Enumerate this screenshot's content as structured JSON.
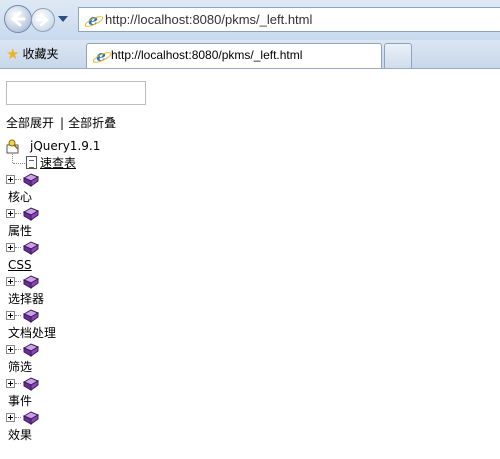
{
  "browser": {
    "address_url": "http://localhost:8080/pkms/_left.html",
    "favorites_label": "收藏夹",
    "tab_title": "http://localhost:8080/pkms/_left.html"
  },
  "page": {
    "search": {
      "value": "",
      "placeholder": ""
    },
    "expand_all": "全部展开",
    "separator": "|",
    "collapse_all": "全部折叠",
    "tree": {
      "root": {
        "label": "jQuery1.9.1",
        "icon": "key-folder-icon"
      },
      "child": {
        "label": "速查表",
        "icon": "document-icon"
      },
      "groups": [
        {
          "label": "核心",
          "underlined": false
        },
        {
          "label": "属性",
          "underlined": false
        },
        {
          "label": "CSS",
          "underlined": true
        },
        {
          "label": "选择器",
          "underlined": false
        },
        {
          "label": "文档处理",
          "underlined": false
        },
        {
          "label": "筛选",
          "underlined": false
        },
        {
          "label": "事件",
          "underlined": false
        },
        {
          "label": "效果",
          "underlined": false
        }
      ]
    }
  }
}
